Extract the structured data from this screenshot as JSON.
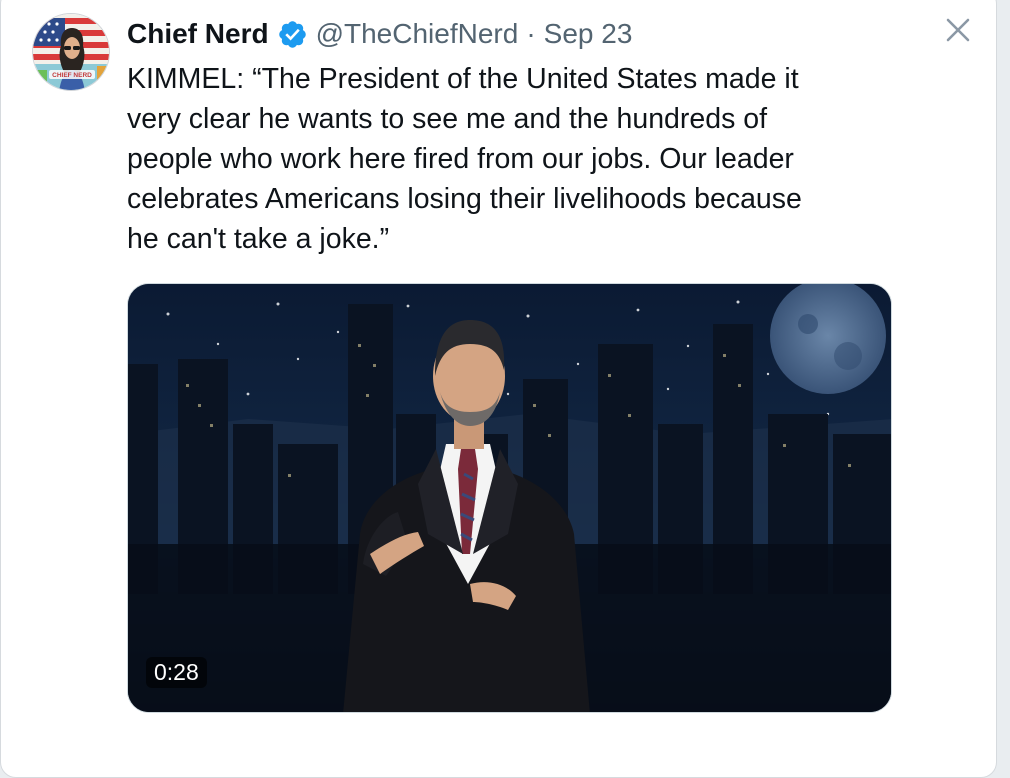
{
  "tweet": {
    "author": {
      "display_name": "Chief Nerd",
      "handle": "@TheChiefNerd",
      "verified": true,
      "avatar_badge_text": "CHIEF NERD"
    },
    "separator": "·",
    "date": "Sep 23",
    "text": "KIMMEL: “The President of the United States made it\nvery clear he wants to see me and the hundreds of\npeople who work here fired from our jobs. Our leader\ncelebrates Americans losing their livelihoods because\nhe can't take a joke.”",
    "media": {
      "type": "video",
      "duration": "0:28"
    }
  },
  "icons": {
    "verified": "verified-badge-icon",
    "close": "close-icon"
  },
  "colors": {
    "verified_blue": "#1d9bf0",
    "text_primary": "#0f1419",
    "text_secondary": "#536471",
    "close_icon": "#8b98a5"
  }
}
